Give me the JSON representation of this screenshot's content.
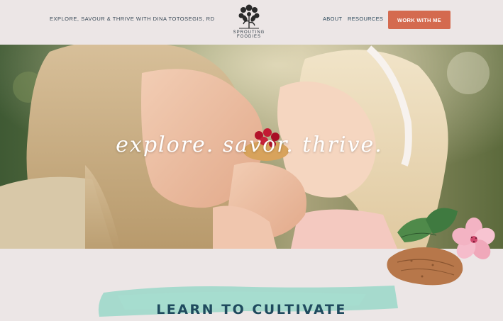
{
  "header": {
    "tagline": "EXPLORE, SAVOUR & THRIVE WITH DINA TOTOSEGIS, RD",
    "logo": {
      "line1": "SPROUTING",
      "line2": "FOODIES",
      "icon": "sprouting-foodies-logo-icon"
    },
    "nav": [
      {
        "label": "ABOUT"
      },
      {
        "label": "RESOURCES"
      }
    ],
    "cta_label": "WORK WITH ME"
  },
  "hero": {
    "script_text": "explore. savor. thrive."
  },
  "section": {
    "title": "LEARN TO CULTIVATE"
  },
  "colors": {
    "background": "#ece6e6",
    "cta": "#d46a4f",
    "title": "#1f4a5e",
    "brush": "#8fd6c4"
  }
}
